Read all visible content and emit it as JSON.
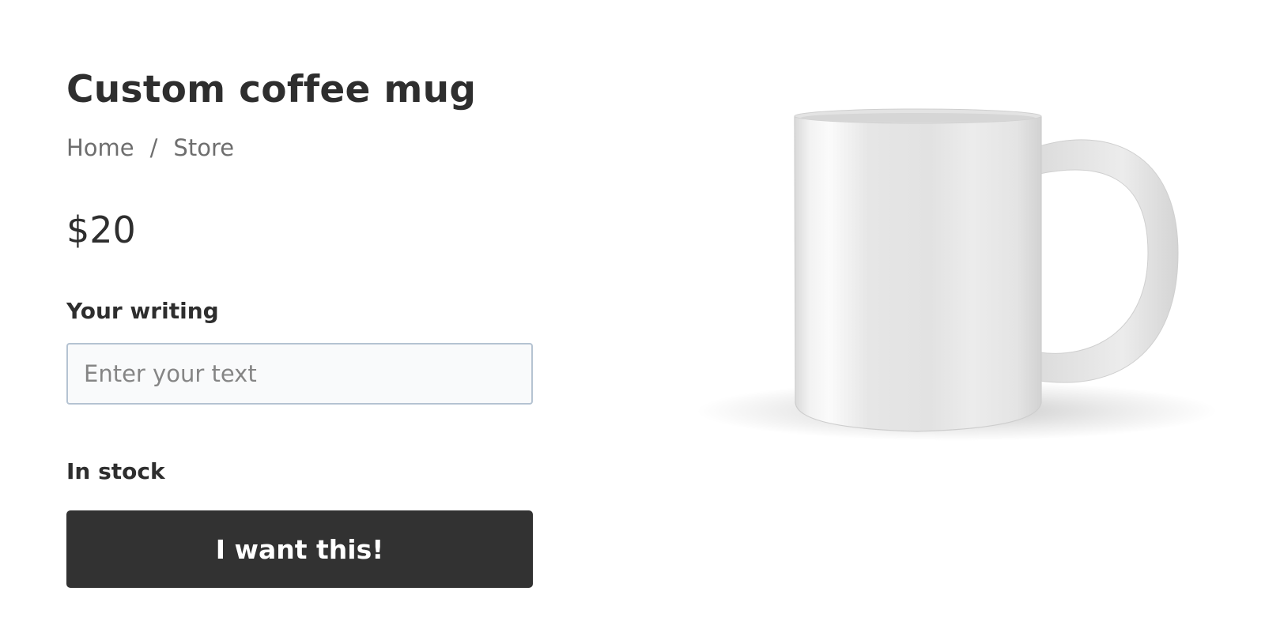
{
  "product": {
    "title": "Custom coffee mug",
    "price": "$20",
    "stock_status": "In stock",
    "image_icon": "coffee-mug-image"
  },
  "breadcrumb": {
    "items": [
      "Home",
      "Store"
    ],
    "separator": "/"
  },
  "form": {
    "writing_label": "Your writing",
    "writing_value": "",
    "writing_placeholder": "Enter your text"
  },
  "actions": {
    "buy_label": "I want this!"
  },
  "colors": {
    "text": "#2e2e2e",
    "muted": "#6e6e6e",
    "button_bg": "#323232",
    "input_border": "#b5c3d2",
    "input_bg": "#f9fafb"
  }
}
